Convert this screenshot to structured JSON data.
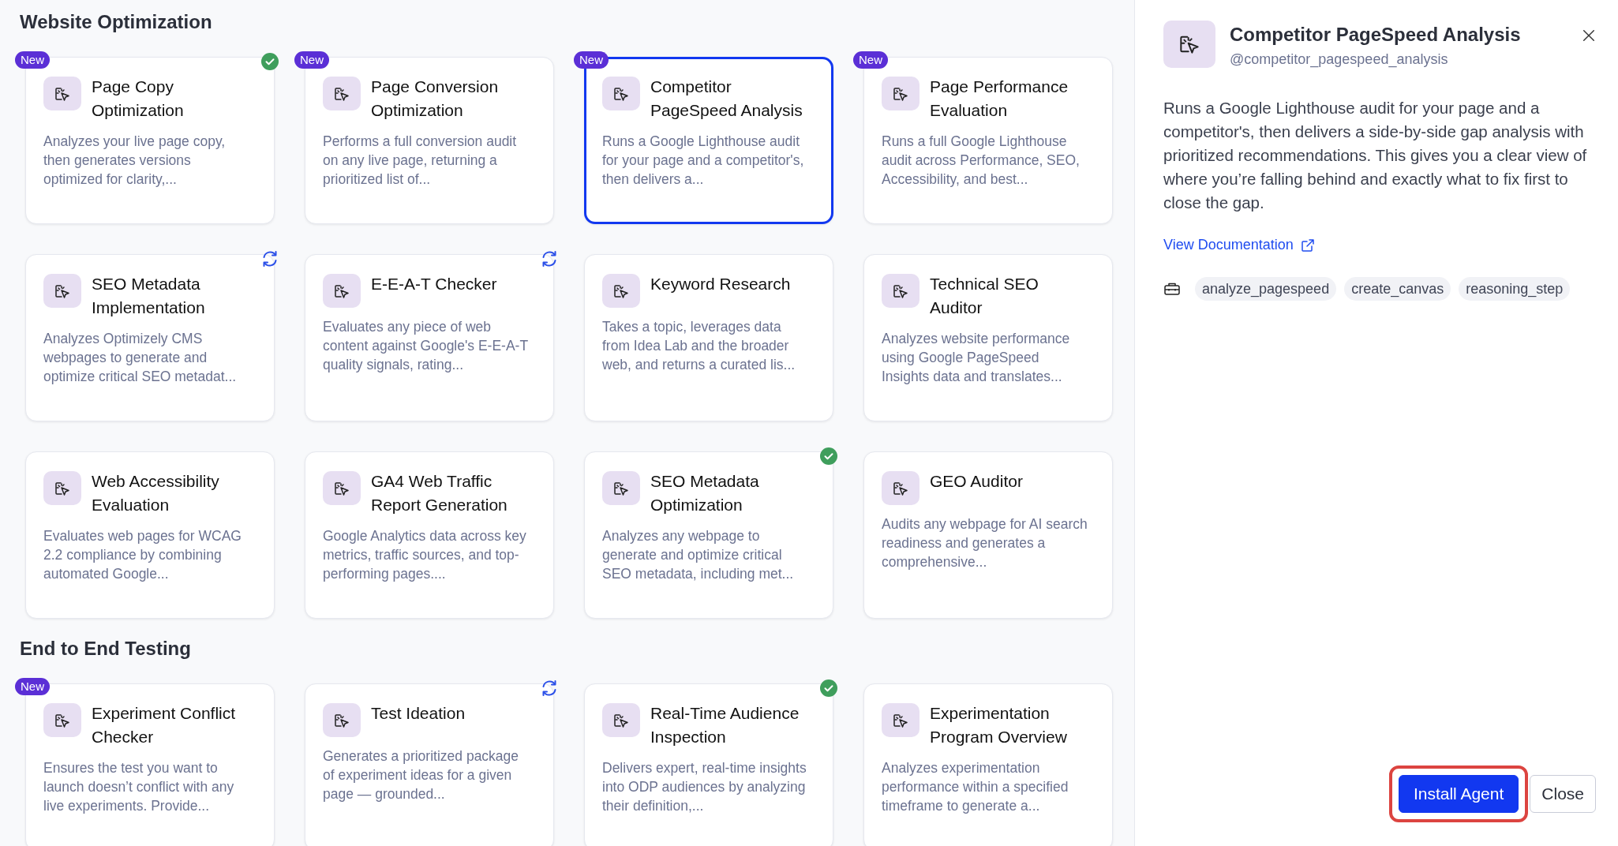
{
  "sections": [
    {
      "title": "Website Optimization",
      "cards": [
        {
          "title": "Page Copy Optimization",
          "description": "Analyzes your live page copy, then generates versions optimized for clarity,...",
          "badge": "New",
          "verified": true,
          "updating": false,
          "selected": false
        },
        {
          "title": "Page Conversion Optimization",
          "description": "Performs a full conversion audit on any live page, returning a prioritized list of...",
          "badge": "New",
          "verified": false,
          "updating": false,
          "selected": false
        },
        {
          "title": "Competitor PageSpeed Analysis",
          "description": "Runs a Google Lighthouse audit for your page and a competitor's, then delivers a...",
          "badge": "New",
          "verified": false,
          "updating": false,
          "selected": true
        },
        {
          "title": "Page Performance Evaluation",
          "description": "Runs a full Google Lighthouse audit across Performance, SEO, Accessibility, and best...",
          "badge": "New",
          "verified": false,
          "updating": false,
          "selected": false
        },
        {
          "title": "SEO Metadata Implementation",
          "description": "Analyzes Optimizely CMS webpages to generate and optimize critical SEO metadat...",
          "verified": false,
          "updating": true,
          "selected": false
        },
        {
          "title": "E-E-A-T Checker",
          "description": "Evaluates any piece of web content against Google's E-E-A-T quality signals, rating...",
          "verified": false,
          "updating": true,
          "selected": false
        },
        {
          "title": "Keyword Research",
          "description": "Takes a topic, leverages data from Idea Lab and the broader web, and returns a curated lis...",
          "verified": false,
          "updating": false,
          "selected": false
        },
        {
          "title": "Technical SEO Auditor",
          "description": "Analyzes website performance using Google PageSpeed Insights data and translates...",
          "verified": false,
          "updating": false,
          "selected": false
        },
        {
          "title": "Web Accessibility Evaluation",
          "description": "Evaluates web pages for WCAG 2.2 compliance by combining automated Google...",
          "verified": false,
          "updating": false,
          "selected": false
        },
        {
          "title": "GA4 Web Traffic Report Generation",
          "description": "Google Analytics data across key metrics, traffic sources, and top-performing pages....",
          "verified": false,
          "updating": false,
          "selected": false
        },
        {
          "title": "SEO Metadata Optimization",
          "description": "Analyzes any webpage to generate and optimize critical SEO metadata, including met...",
          "verified": true,
          "updating": false,
          "selected": false
        },
        {
          "title": "GEO Auditor",
          "description": "Audits any webpage for AI search readiness and generates a comprehensive...",
          "verified": false,
          "updating": false,
          "selected": false
        }
      ]
    },
    {
      "title": "End to End Testing",
      "cards": [
        {
          "title": "Experiment Conflict Checker",
          "description": "Ensures the test you want to launch doesn’t conflict with any live experiments. Provide...",
          "badge": "New",
          "verified": false,
          "updating": false,
          "selected": false
        },
        {
          "title": "Test Ideation",
          "description": "Generates a prioritized package of experiment ideas for a given page — grounded...",
          "verified": false,
          "updating": true,
          "selected": false
        },
        {
          "title": "Real-Time Audience Inspection",
          "description": "Delivers expert, real-time insights into ODP audiences by analyzing their definition,...",
          "verified": true,
          "updating": false,
          "selected": false
        },
        {
          "title": "Experimentation Program Overview",
          "description": "Analyzes experimentation performance within a specified timeframe to generate a...",
          "verified": false,
          "updating": false,
          "selected": false
        }
      ]
    }
  ],
  "panel": {
    "title": "Competitor PageSpeed Analysis",
    "handle": "@competitor_pagespeed_analysis",
    "description": "Runs a Google Lighthouse audit for your page and a competitor's, then delivers a side-by-side gap analysis with prioritized recommendations. This gives you a clear view of where you’re falling behind and exactly what to fix first to close the gap.",
    "doc_link": "View Documentation",
    "tools": [
      "analyze_pagespeed",
      "create_canvas",
      "reasoning_step"
    ],
    "buttons": [
      {
        "label": "Install Agent",
        "kind": "primary",
        "highlighted": true
      },
      {
        "label": "Close",
        "kind": "secondary",
        "highlighted": false
      }
    ]
  }
}
